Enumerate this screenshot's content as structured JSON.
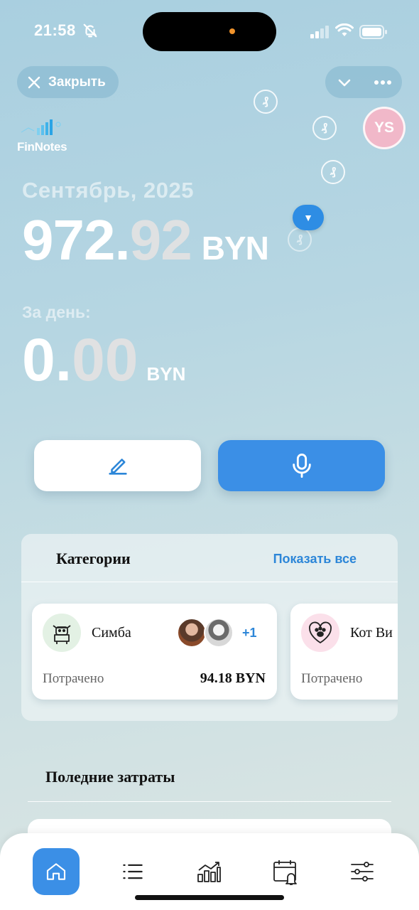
{
  "status": {
    "time": "21:58"
  },
  "header": {
    "close_label": "Закрыть",
    "avatar_initials": "YS"
  },
  "logo": {
    "text": "FinNotes"
  },
  "summary": {
    "month": "Сентябрь, 2025",
    "total_int": "972.",
    "total_dec": "92",
    "currency": "BYN",
    "per_day_label": "За день:",
    "per_day_int": "0.",
    "per_day_dec": "00",
    "per_day_currency": "BYN"
  },
  "categories": {
    "title": "Категории",
    "show_all": "Показать все",
    "items": [
      {
        "name": "Симба",
        "extra_members": "+1",
        "spent_label": "Потрачено",
        "spent_value": "94.18 BYN",
        "icon": "cow-icon",
        "icon_bg": "#e3f1e4"
      },
      {
        "name": "Кот Ви",
        "spent_label": "Потрачено",
        "icon": "paw-heart-icon",
        "icon_bg": "#fbe0ea"
      }
    ]
  },
  "recent": {
    "title": "Поледние затраты"
  },
  "colors": {
    "accent": "#3b8fe6",
    "link": "#2c86d8"
  },
  "tabs": [
    "home-icon",
    "list-icon",
    "chart-icon",
    "calendar-icon",
    "settings-icon"
  ]
}
